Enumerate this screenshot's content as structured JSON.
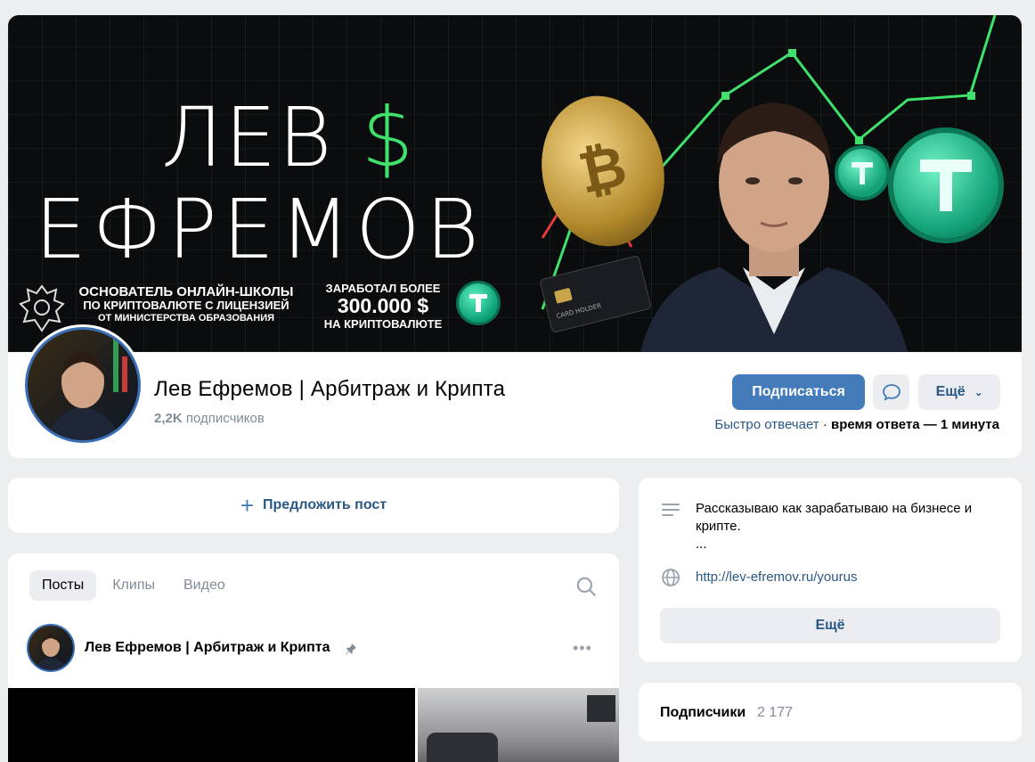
{
  "cover": {
    "title_line1": "ЛЕВ",
    "title_dollar": "$",
    "title_line2": "ЕФРЕМОВ",
    "school_line1": "ОСНОВАТЕЛЬ ОНЛАЙН-ШКОЛЫ",
    "school_line2": "ПО КРИПТОВАЛЮТЕ С ЛИЦЕНЗИЕЙ",
    "school_line3": "ОТ МИНИСТЕРСТВА ОБРАЗОВАНИЯ",
    "earn_line1": "ЗАРАБОТАЛ БОЛЕЕ",
    "earn_line2": "300.000 $",
    "earn_line3": "НА КРИПТОВАЛЮТЕ",
    "card_text": "CARD HOLDER",
    "accent_green": "#3fe06b"
  },
  "header": {
    "group_name": "Лев Ефремов | Арбитраж и Крипта",
    "subs_count": "2,2K",
    "subs_label": "подписчиков",
    "subscribe_label": "Подписаться",
    "more_label": "Ещё",
    "reply_fast": "Быстро отвечает",
    "reply_sep": " · ",
    "reply_time": "время ответа — 1 минута",
    "brand_color": "#447bba"
  },
  "suggest": {
    "label": "Предложить пост"
  },
  "posts": {
    "tabs": [
      {
        "label": "Посты",
        "active": true
      },
      {
        "label": "Клипы",
        "active": false
      },
      {
        "label": "Видео",
        "active": false
      }
    ],
    "author": "Лев Ефремов | Арбитраж и Крипта",
    "menu": "•••"
  },
  "info": {
    "description": "Рассказываю как зарабатываю на бизнесе и крипте.",
    "ellipsis": "...",
    "link": "http://lev-efremov.ru/yourus",
    "more_label": "Ещё"
  },
  "members": {
    "title": "Подписчики",
    "count": "2 177"
  }
}
